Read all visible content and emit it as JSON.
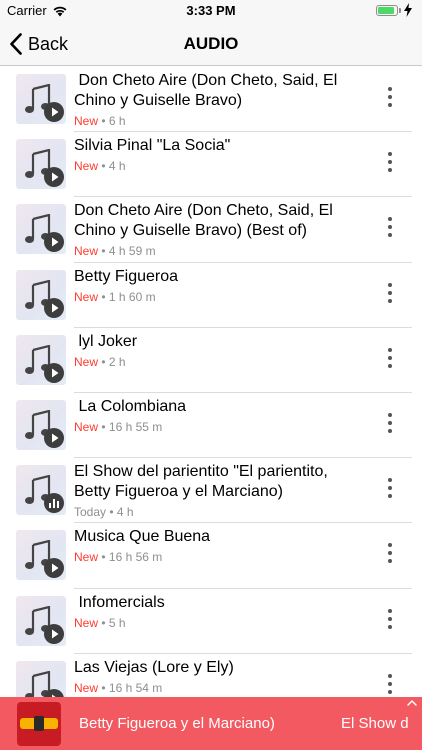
{
  "status_bar": {
    "carrier": "Carrier",
    "time": "3:33 PM",
    "battery_level": 0.9
  },
  "nav": {
    "back_label": "Back",
    "title": "AUDIO"
  },
  "episodes": [
    {
      "title": " Don Cheto Aire (Don Cheto, Said, El Chino y Guiselle Bravo)",
      "status": "New",
      "duration": "6 h",
      "state_icon": "play-icon"
    },
    {
      "title": "Silvia Pinal \"La Socia\"",
      "status": "New",
      "duration": "4 h",
      "state_icon": "play-icon"
    },
    {
      "title": "Don Cheto Aire (Don Cheto, Said, El Chino y Guiselle Bravo) (Best of)",
      "status": "New",
      "duration": "4 h 59 m",
      "state_icon": "play-icon"
    },
    {
      "title": "Betty Figueroa",
      "status": "New",
      "duration": "1 h 60 m",
      "state_icon": "play-icon"
    },
    {
      "title": " lyl Joker",
      "status": "New",
      "duration": "2 h",
      "state_icon": "play-icon"
    },
    {
      "title": " La Colombiana",
      "status": "New",
      "duration": "16 h 55 m",
      "state_icon": "play-icon"
    },
    {
      "title": "El Show del parientito \"El parientito, Betty Figueroa y el Marciano)",
      "status": "Today",
      "duration": "4 h",
      "state_icon": "equalizer-icon"
    },
    {
      "title": "Musica Que Buena",
      "status": "New",
      "duration": "16 h 56 m",
      "state_icon": "play-icon"
    },
    {
      "title": " Infomercials",
      "status": "New",
      "duration": "5 h",
      "state_icon": "play-icon"
    },
    {
      "title": "Las Viejas (Lore y Ely)",
      "status": "New",
      "duration": "16 h 54 m",
      "state_icon": "play-icon"
    }
  ],
  "player": {
    "now_playing": "Betty Figueroa y el Marciano)",
    "now_playing_next": "El Show d"
  },
  "colors": {
    "new_badge": "#ff3b30",
    "player_background": "#f25961",
    "battery": "#4cd964"
  }
}
